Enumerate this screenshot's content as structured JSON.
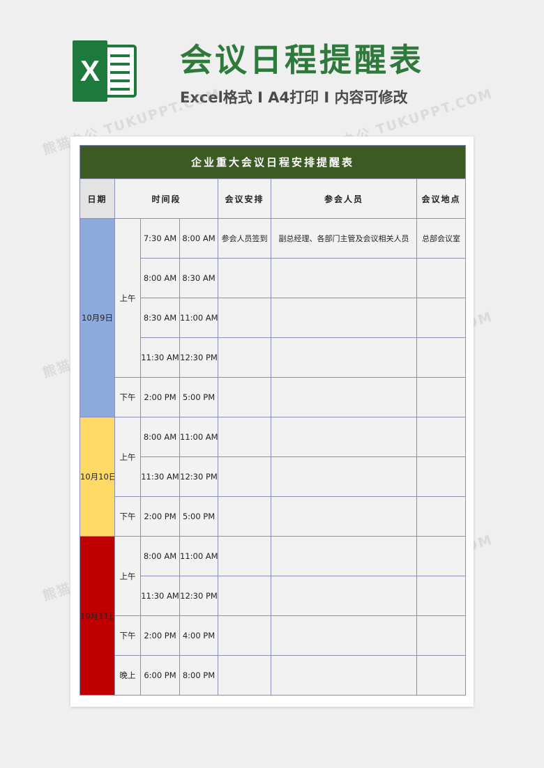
{
  "header": {
    "title": "会议日程提醒表",
    "subtitle": "Excel格式 I A4打印 I 内容可修改",
    "watermark": "熊猫办公 TUKUPPT.COM"
  },
  "colors": {
    "title_green": "#2e7a3b",
    "table_header": "#3b5a24",
    "date1": "#8eaadc",
    "date2": "#ffd966",
    "date3": "#c00000"
  },
  "table": {
    "title": "企业重大会议日程安排提醒表",
    "headers": {
      "date": "日期",
      "time": "时间段",
      "arrangement": "会议安排",
      "attendees": "参会人员",
      "location": "会议地点"
    },
    "days": [
      {
        "date": "10月9日",
        "periods": [
          {
            "label": "上午",
            "slots": [
              {
                "start": "7:30 AM",
                "end": "8:00 AM",
                "arrangement": "参会人员签到",
                "attendees": "副总经理、各部门主管及会议相关人员",
                "location": "总部会议室"
              },
              {
                "start": "8:00 AM",
                "end": "8:30 AM",
                "arrangement": "",
                "attendees": "",
                "location": ""
              },
              {
                "start": "8:30 AM",
                "end": "11:00 AM",
                "arrangement": "",
                "attendees": "",
                "location": ""
              },
              {
                "start": "11:30 AM",
                "end": "12:30 PM",
                "arrangement": "",
                "attendees": "",
                "location": ""
              }
            ]
          },
          {
            "label": "下午",
            "slots": [
              {
                "start": "2:00 PM",
                "end": "5:00 PM",
                "arrangement": "",
                "attendees": "",
                "location": ""
              }
            ]
          }
        ]
      },
      {
        "date": "10月10日",
        "periods": [
          {
            "label": "上午",
            "slots": [
              {
                "start": "8:00 AM",
                "end": "11:00 AM",
                "arrangement": "",
                "attendees": "",
                "location": ""
              },
              {
                "start": "11:30 AM",
                "end": "12:30 PM",
                "arrangement": "",
                "attendees": "",
                "location": ""
              }
            ]
          },
          {
            "label": "下午",
            "slots": [
              {
                "start": "2:00 PM",
                "end": "5:00 PM",
                "arrangement": "",
                "attendees": "",
                "location": ""
              }
            ]
          }
        ]
      },
      {
        "date": "10月11日",
        "periods": [
          {
            "label": "上午",
            "slots": [
              {
                "start": "8:00 AM",
                "end": "11:00 AM",
                "arrangement": "",
                "attendees": "",
                "location": ""
              },
              {
                "start": "11:30 AM",
                "end": "12:30 PM",
                "arrangement": "",
                "attendees": "",
                "location": ""
              }
            ]
          },
          {
            "label": "下午",
            "slots": [
              {
                "start": "2:00 PM",
                "end": "4:00 PM",
                "arrangement": "",
                "attendees": "",
                "location": ""
              }
            ]
          },
          {
            "label": "晚上",
            "slots": [
              {
                "start": "6:00 PM",
                "end": "8:00 PM",
                "arrangement": "",
                "attendees": "",
                "location": ""
              }
            ]
          }
        ]
      }
    ]
  }
}
